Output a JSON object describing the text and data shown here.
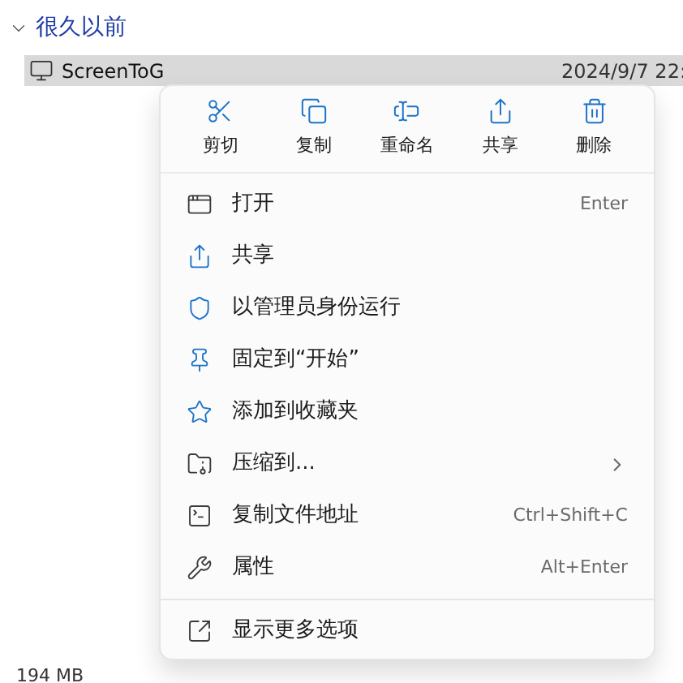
{
  "group": {
    "title": "很久以前",
    "expanded": true
  },
  "file": {
    "name": "ScreenToG",
    "date": "2024/9/7 22:",
    "selected": true
  },
  "size": "194 MB",
  "menu": {
    "actions": [
      {
        "label": "剪切"
      },
      {
        "label": "复制"
      },
      {
        "label": "重命名"
      },
      {
        "label": "共享"
      },
      {
        "label": "删除"
      }
    ],
    "items": [
      {
        "label": "打开",
        "shortcut": "Enter",
        "submenu": false
      },
      {
        "label": "共享",
        "submenu": false
      },
      {
        "label": "以管理员身份运行",
        "submenu": false
      },
      {
        "label": "固定到“开始”",
        "submenu": false
      },
      {
        "label": "添加到收藏夹",
        "submenu": false
      },
      {
        "label": "压缩到...",
        "submenu": true
      },
      {
        "label": "复制文件地址",
        "shortcut": "Ctrl+Shift+C",
        "submenu": false
      },
      {
        "label": "属性",
        "shortcut": "Alt+Enter",
        "submenu": false
      }
    ],
    "more": {
      "label": "显示更多选项"
    }
  }
}
